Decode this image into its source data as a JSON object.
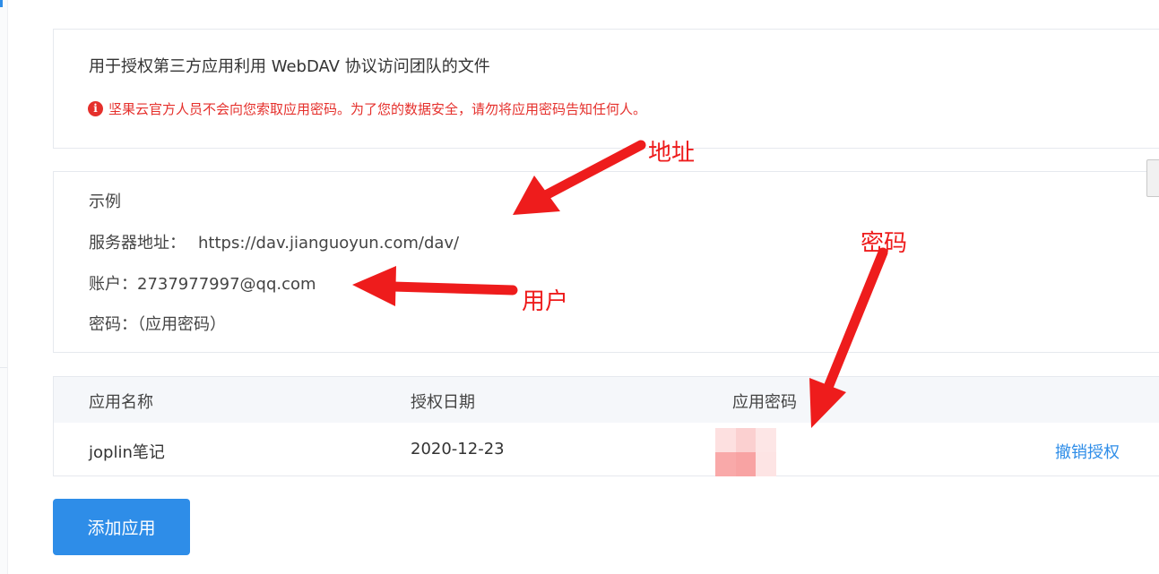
{
  "info": {
    "description": "用于授权第三方应用利用 WebDAV 协议访问团队的文件",
    "warning": "坚果云官方人员不会向您索取应用密码。为了您的数据安全，请勿将应用密码告知任何人。",
    "warning_icon": "info-circle-icon"
  },
  "example": {
    "title": "示例",
    "server_label": "服务器地址：",
    "server_value": "https://dav.jianguoyun.com/dav/",
    "account_label": "账户：",
    "account_value": "2737977997@qq.com",
    "password_label": "密码：",
    "password_value": "（应用密码）"
  },
  "table": {
    "headers": [
      "应用名称",
      "授权日期",
      "应用密码"
    ],
    "rows": [
      {
        "name": "joplin笔记",
        "date": "2020-12-23",
        "action": "撤销授权"
      }
    ]
  },
  "buttons": {
    "add_app": "添加应用"
  },
  "annotations": {
    "address": "地址",
    "password": "密码",
    "user": "用户",
    "color": "#ee1c1c"
  },
  "colors": {
    "accent": "#2e8de8",
    "warning": "#e5302c"
  }
}
